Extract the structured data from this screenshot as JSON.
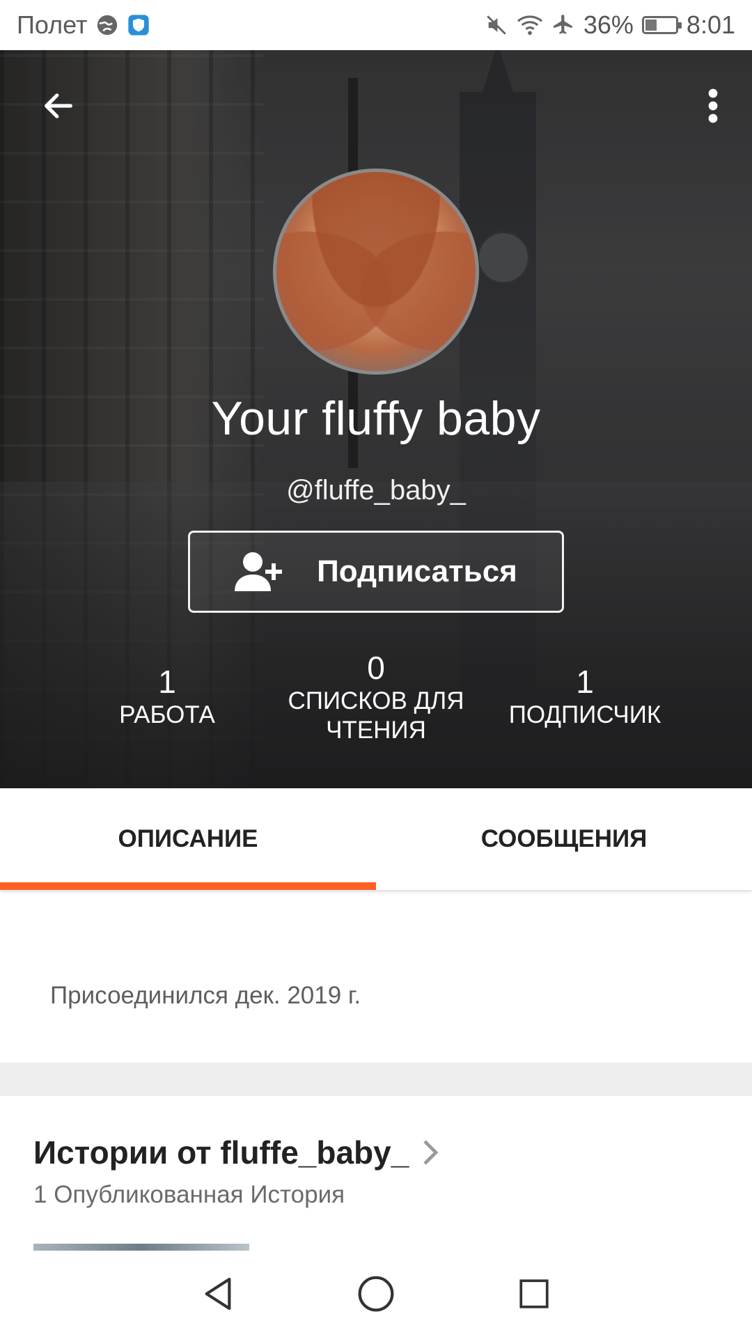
{
  "status_bar": {
    "carrier": "Полет",
    "battery_percent": "36%",
    "battery_level": 0.36,
    "time": "8:01",
    "icons": [
      "globe-icon",
      "shield-icon",
      "mute-icon",
      "wifi-icon",
      "airplane-icon",
      "battery-icon"
    ]
  },
  "profile": {
    "display_name": "Your fluffy baby",
    "username": "@fluffe_baby_",
    "follow_label": "Подписаться",
    "stats": [
      {
        "value": "1",
        "label": "РАБОТА"
      },
      {
        "value": "0",
        "label": "СПИСКОВ ДЛЯ ЧТЕНИЯ"
      },
      {
        "value": "1",
        "label": "ПОДПИСЧИК"
      }
    ]
  },
  "tabs": {
    "items": [
      {
        "label": "ОПИСАНИЕ",
        "active": true
      },
      {
        "label": "СООБЩЕНИЯ",
        "active": false
      }
    ]
  },
  "about": {
    "joined": "Присоединился дек. 2019 г."
  },
  "stories": {
    "title": "Истории от fluffe_baby_",
    "count": "1 Опубликованная История"
  },
  "colors": {
    "accent": "#ff6122",
    "text": "#222222",
    "muted": "#5e5e5e",
    "divider": "#eeeeee"
  },
  "nav": {
    "icons": [
      "back-triangle-icon",
      "home-circle-icon",
      "recents-square-icon"
    ]
  }
}
